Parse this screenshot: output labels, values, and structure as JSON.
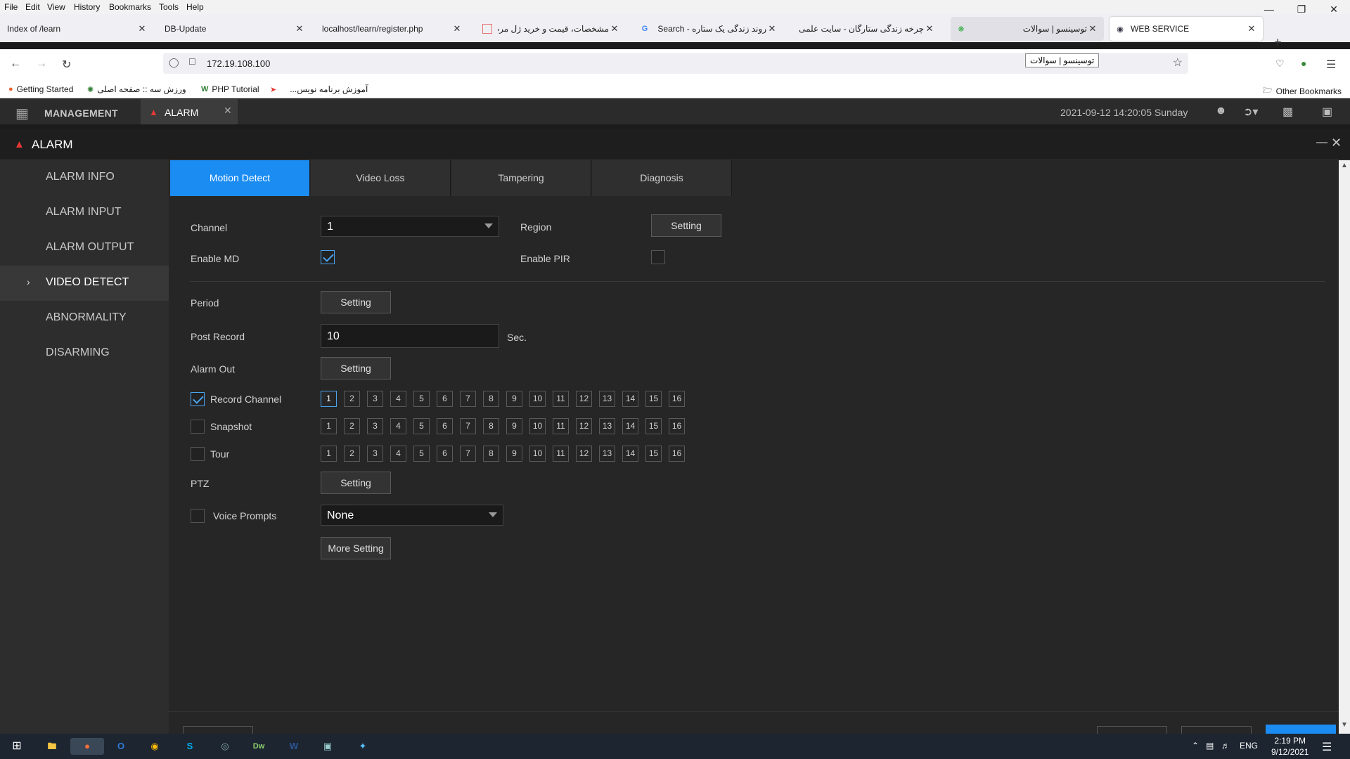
{
  "browser": {
    "menu": [
      "File",
      "Edit",
      "View",
      "History",
      "Bookmarks",
      "Tools",
      "Help"
    ],
    "tabs": [
      {
        "title": "Index of /learn"
      },
      {
        "title": "DB-Update"
      },
      {
        "title": "localhost/learn/register.php"
      },
      {
        "title": "مشخصات، قیمت و خرید ژل مرطو..."
      },
      {
        "title": "روند زندگی یک ستاره - Google Search"
      },
      {
        "title": "چرخه زندگی ستارگان - سایت علمی بیگ..."
      },
      {
        "title": "توسینسو | سوالات"
      },
      {
        "title": "WEB SERVICE"
      }
    ],
    "url": "172.19.108.100",
    "tooltip": "توسینسو | سوالات",
    "bookmarks": [
      "Getting Started",
      "ورزش سه :: صفحه اصلی",
      "PHP Tutorial",
      "آموزش برنامه نویس...",
      "Other Bookmarks"
    ]
  },
  "app": {
    "management_label": "MANAGEMENT",
    "alarm_tab_label": "ALARM",
    "datetime": "2021-09-12 14:20:05 Sunday",
    "panel_title": "ALARM"
  },
  "sidebar": {
    "items": [
      {
        "label": "ALARM INFO"
      },
      {
        "label": "ALARM INPUT"
      },
      {
        "label": "ALARM OUTPUT"
      },
      {
        "label": "VIDEO DETECT",
        "selected": true
      },
      {
        "label": "ABNORMALITY"
      },
      {
        "label": "DISARMING"
      }
    ]
  },
  "tabs": [
    {
      "label": "Motion Detect",
      "active": true
    },
    {
      "label": "Video Loss"
    },
    {
      "label": "Tampering"
    },
    {
      "label": "Diagnosis"
    }
  ],
  "form": {
    "channel_label": "Channel",
    "channel_value": "1",
    "region_label": "Region",
    "setting_label": "Setting",
    "enable_md_label": "Enable MD",
    "enable_md_checked": true,
    "enable_pir_label": "Enable PIR",
    "enable_pir_checked": false,
    "period_label": "Period",
    "post_record_label": "Post Record",
    "post_record_value": "10",
    "post_record_unit": "Sec.",
    "alarm_out_label": "Alarm Out",
    "record_channel_label": "Record Channel",
    "record_channel_checked": true,
    "snapshot_label": "Snapshot",
    "snapshot_checked": false,
    "tour_label": "Tour",
    "tour_checked": false,
    "ptz_label": "PTZ",
    "voice_prompts_label": "Voice Prompts",
    "voice_prompts_checked": false,
    "voice_prompts_value": "None",
    "more_setting_label": "More Setting",
    "channels": [
      "1",
      "2",
      "3",
      "4",
      "5",
      "6",
      "7",
      "8",
      "9",
      "10",
      "11",
      "12",
      "13",
      "14",
      "15",
      "16"
    ],
    "record_selected": [
      "1"
    ]
  },
  "taskbar": {
    "lang": "ENG",
    "time": "2:19 PM",
    "date": "9/12/2021"
  },
  "colors": {
    "accent": "#1b8cf2",
    "alarm_red": "#e53935",
    "check_blue": "#4aa3f0"
  }
}
